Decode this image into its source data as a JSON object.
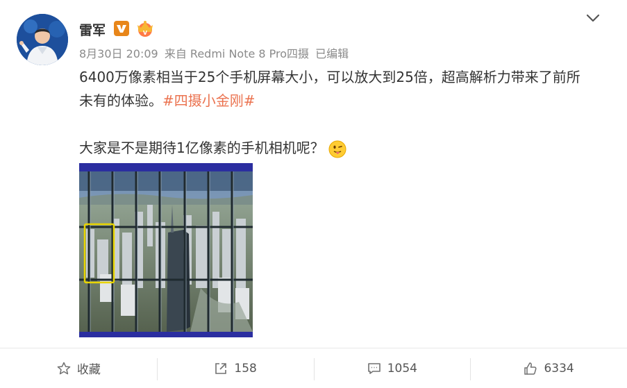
{
  "user": {
    "name": "雷军"
  },
  "meta": {
    "time": "8月30日 20:09",
    "source": "来自 Redmi Note 8 Pro四摄",
    "edited": "已编辑"
  },
  "post": {
    "line1": "6400万像素相当于25个手机屏幕大小，可以放大到25倍，超高解析力带来了前所",
    "line2_text": "未有的体验。",
    "hashtag": "#四摄小金刚#",
    "line3": "大家是不是期待1亿像素的手机相机呢？"
  },
  "actions": {
    "favorite_label": "收藏",
    "repost_count": "158",
    "comment_count": "1054",
    "like_count": "6334"
  },
  "colors": {
    "hashtag": "#eb7350",
    "meta": "#8a8a8a",
    "verified": "#e8861a"
  },
  "icons": [
    "vip-v-badge-icon",
    "crown-badge-icon",
    "chevron-down-icon",
    "tongue-emoji-icon",
    "star-icon",
    "share-icon",
    "comment-icon",
    "thumbs-up-icon"
  ]
}
